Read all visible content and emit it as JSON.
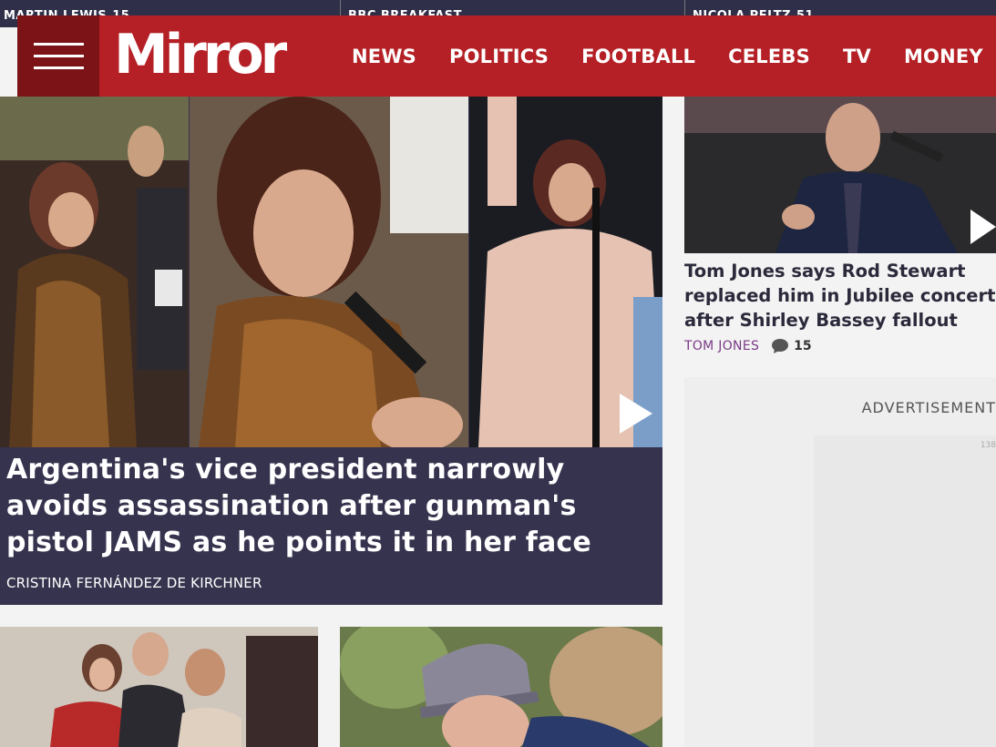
{
  "ticker": {
    "items": [
      {
        "label": "MARTIN LEWIS",
        "count": "15"
      },
      {
        "label": "BBC BREAKFAST",
        "count": ""
      },
      {
        "label": "NICOLA PELTZ",
        "count": "51"
      }
    ]
  },
  "nav": {
    "logo": "Mirror",
    "links": [
      "NEWS",
      "POLITICS",
      "FOOTBALL",
      "CELEBS",
      "TV",
      "MONEY"
    ]
  },
  "hero": {
    "title": "Argentina's vice president narrowly avoids assassination after gunman's pistol JAMS as he points it in her face",
    "tag": "CRISTINA FERNÁNDEZ DE KIRCHNER"
  },
  "side_story": {
    "title_lines": [
      "Tom Jones says Rod Stewart",
      "replaced him in Jubilee concert",
      "after Shirley Bassey fallout"
    ],
    "tag": "TOM JONES",
    "comments": "15"
  },
  "advert": {
    "label": "ADVERTISEMENT",
    "number": "138"
  },
  "colors": {
    "brand_red": "#b42025",
    "brand_dark_red": "#7c1417",
    "hero_bg": "#36334e",
    "tag_purple": "#7a3a86"
  }
}
